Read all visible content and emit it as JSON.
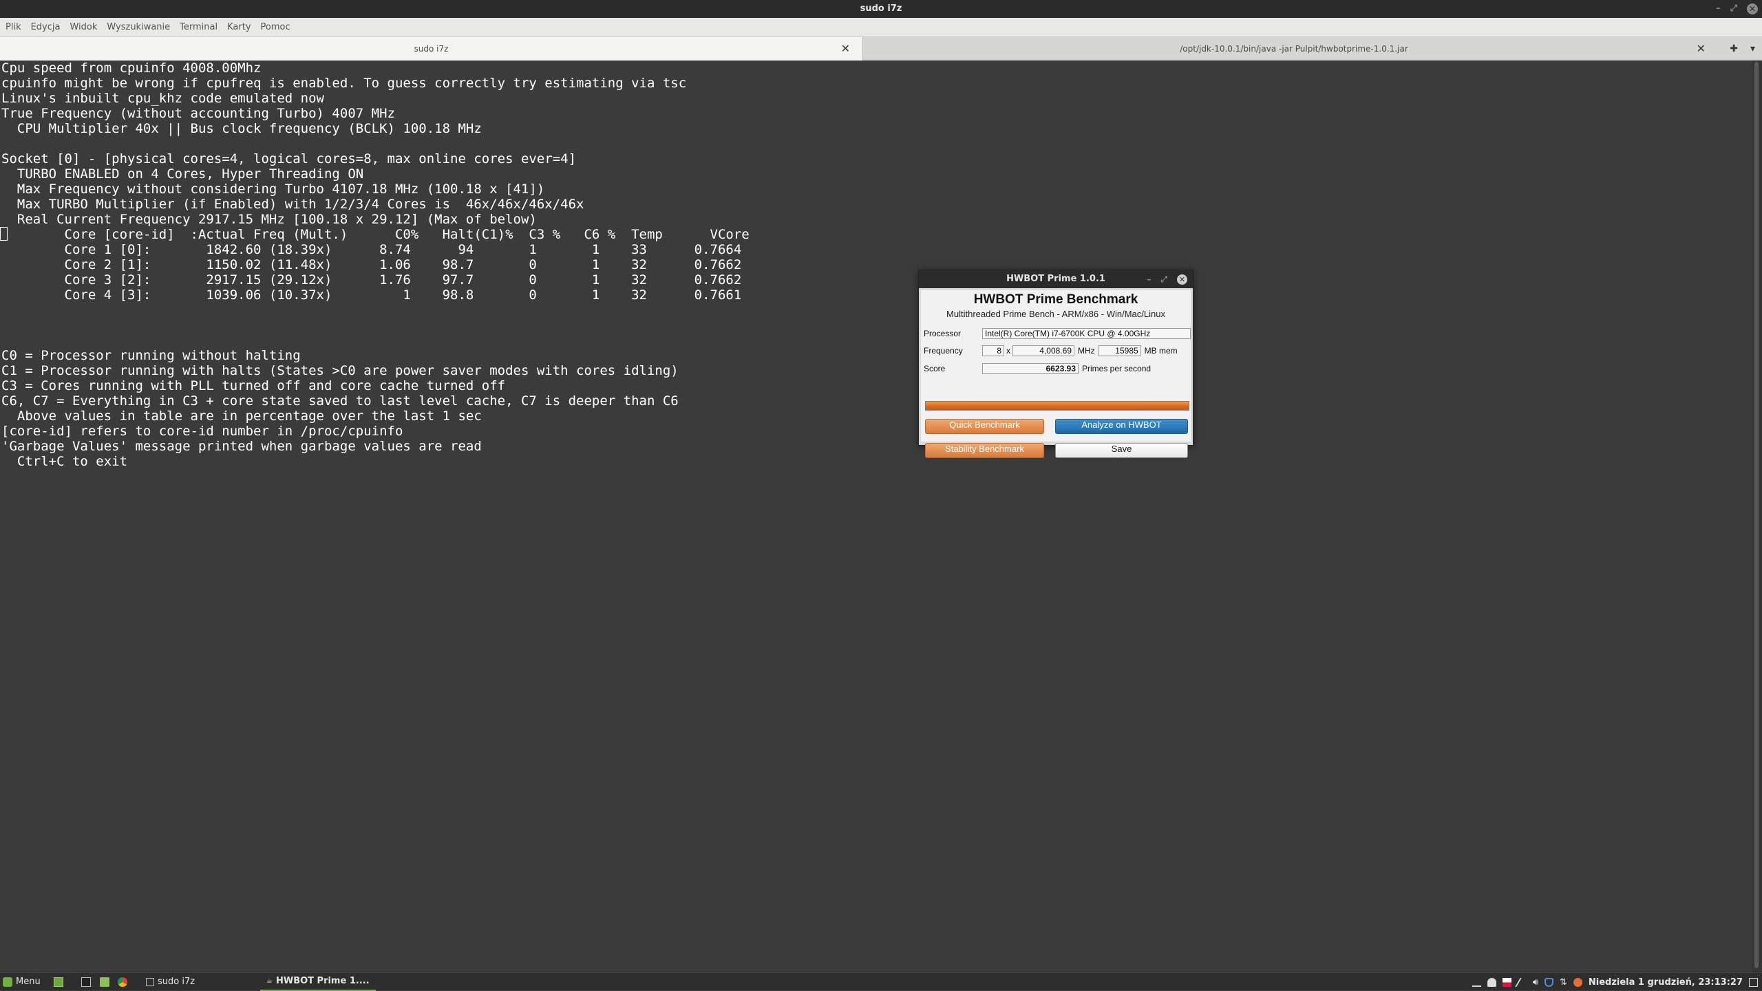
{
  "window": {
    "title": "sudo i7z",
    "controls": {
      "minimize": "–",
      "maximize": "⤢",
      "close": "✕"
    }
  },
  "menu": [
    "Plik",
    "Edycja",
    "Widok",
    "Wyszukiwanie",
    "Terminal",
    "Karty",
    "Pomoc"
  ],
  "tabs": [
    {
      "label": "sudo i7z",
      "active": true
    },
    {
      "label": "/opt/jdk-10.0.1/bin/java -jar Pulpit/hwbotprime-1.0.1.jar",
      "active": false
    }
  ],
  "tab_close": "✕",
  "tab_extra": {
    "new_tab": "✚",
    "menu": "▾"
  },
  "terminal": {
    "lines": [
      "Cpu speed from cpuinfo 4008.00Mhz",
      "cpuinfo might be wrong if cpufreq is enabled. To guess correctly try estimating via tsc",
      "Linux's inbuilt cpu_khz code emulated now",
      "True Frequency (without accounting Turbo) 4007 MHz",
      "  CPU Multiplier 40x || Bus clock frequency (BCLK) 100.18 MHz",
      "",
      "Socket [0] - [physical cores=4, logical cores=8, max online cores ever=4]",
      "  TURBO ENABLED on 4 Cores, Hyper Threading ON",
      "  Max Frequency without considering Turbo 4107.18 MHz (100.18 x [41])",
      "  Max TURBO Multiplier (if Enabled) with 1/2/3/4 Cores is  46x/46x/46x/46x",
      "  Real Current Frequency 2917.15 MHz [100.18 x 29.12] (Max of below)",
      "        Core [core-id]  :Actual Freq (Mult.)      C0%   Halt(C1)%  C3 %   C6 %  Temp      VCore",
      "        Core 1 [0]:       1842.60 (18.39x)      8.74      94       1       1    33      0.7664",
      "        Core 2 [1]:       1150.02 (11.48x)      1.06    98.7       0       1    32      0.7662",
      "        Core 3 [2]:       2917.15 (29.12x)      1.76    97.7       0       1    32      0.7662",
      "        Core 4 [3]:       1039.06 (10.37x)         1    98.8       0       1    32      0.7661",
      "",
      "",
      "",
      "C0 = Processor running without halting",
      "C1 = Processor running with halts (States >C0 are power saver modes with cores idling)",
      "C3 = Cores running with PLL turned off and core cache turned off",
      "C6, C7 = Everything in C3 + core state saved to last level cache, C7 is deeper than C6",
      "  Above values in table are in percentage over the last 1 sec",
      "[core-id] refers to core-id number in /proc/cpuinfo",
      "'Garbage Values' message printed when garbage values are read",
      "  Ctrl+C to exit"
    ]
  },
  "hwbot": {
    "title": "HWBOT Prime 1.0.1",
    "controls": {
      "minimize": "–",
      "maximize": "⤢",
      "close": "✕"
    },
    "heading": "HWBOT Prime Benchmark",
    "subtitle": "Multithreaded Prime Bench - ARM/x86 - Win/Mac/Linux",
    "processor_label": "Processor",
    "processor_value": "Intel(R) Core(TM) i7-6700K CPU @ 4.00GHz",
    "frequency_label": "Frequency",
    "threads": "8",
    "x_sep": "x",
    "frequency_value": "4,008.69",
    "mhz": "MHz",
    "mem_value": "15985",
    "mem_unit": "MB mem",
    "score_label": "Score",
    "score_value": "6623.93",
    "score_unit": "Primes per second",
    "progress": 1.0,
    "buttons": {
      "quick": "Quick Benchmark",
      "analyze": "Analyze on HWBOT",
      "stability": "Stability Benchmark",
      "save": "Save"
    },
    "colors": {
      "orange": "#d97b39",
      "blue": "#1f6aa6"
    }
  },
  "panel": {
    "menu_label": "Menu",
    "tasks": [
      {
        "label": "sudo i7z"
      },
      {
        "label": "HWBOT Prime 1...."
      }
    ],
    "clock": "Niedziela  1 grudzień, 23:13:27"
  }
}
